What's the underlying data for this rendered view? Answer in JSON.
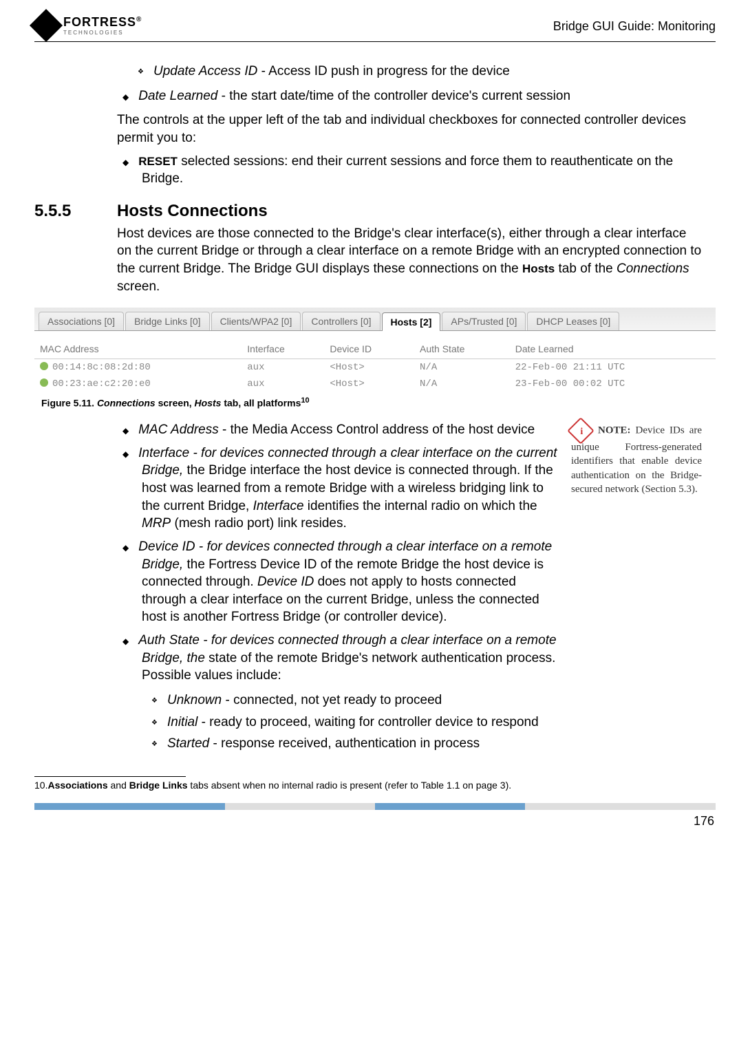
{
  "header": {
    "logo_main": "FORTRESS",
    "logo_sub": "TECHNOLOGIES",
    "right": "Bridge GUI Guide: Monitoring"
  },
  "intro": {
    "sub_item_term": "Update Access ID",
    "sub_item_rest": " - Access ID push in progress for the device",
    "date_learned_term": "Date Learned",
    "date_learned_rest": " - the start date/time of the controller device's current session",
    "para1": "The controls at the upper left of the tab and individual checkboxes for connected controller devices permit you to:",
    "reset_caps": "RESET",
    "reset_rest": " selected sessions: end their current sessions and force them to reauthenticate on the Bridge."
  },
  "section": {
    "num": "5.5.5",
    "title": "Hosts Connections",
    "para_a": "Host devices are those connected to the Bridge's clear interface(s), either through a clear interface on the current Bridge or through a clear interface on a remote Bridge with an encrypted connection to the current Bridge. The Bridge GUI displays these connections on the ",
    "hosts_bold": "Hosts",
    "para_b": " tab of the ",
    "connections_ital": "Connections",
    "para_c": " screen."
  },
  "tabs": [
    "Associations [0]",
    "Bridge Links [0]",
    "Clients/WPA2 [0]",
    "Controllers [0]",
    "Hosts [2]",
    "APs/Trusted [0]",
    "DHCP Leases [0]"
  ],
  "table": {
    "headers": [
      "MAC Address",
      "Interface",
      "Device ID",
      "Auth State",
      "Date Learned"
    ],
    "rows": [
      {
        "mac": "00:14:8c:08:2d:80",
        "iface": "aux",
        "dev": "<Host>",
        "auth": "N/A",
        "date": "22-Feb-00 21:11 UTC"
      },
      {
        "mac": "00:23:ae:c2:20:e0",
        "iface": "aux",
        "dev": "<Host>",
        "auth": "N/A",
        "date": "23-Feb-00 00:02 UTC"
      }
    ]
  },
  "caption": {
    "prefix": "Figure 5.11. ",
    "ital1": "Connections",
    "mid": " screen, ",
    "ital2": "Hosts",
    "suffix": " tab, all platforms",
    "fn": "10"
  },
  "defs": {
    "mac_term": "MAC Address",
    "mac_rest": " - the Media Access Control address of the host device",
    "iface_term": "Interface",
    "iface_ital": " - for devices connected through a clear interface on the current Bridge,",
    "iface_rest_a": " the Bridge interface the host device is connected through. If the host was learned from a remote Bridge with a wireless bridging link to the current Bridge, ",
    "iface_ital2": "Interface",
    "iface_rest_b": " identifies the internal radio on which the ",
    "mrp_ital": "MRP",
    "iface_rest_c": " (mesh radio port) link resides.",
    "dev_term": "Device ID",
    "dev_ital": " - for devices connected through a clear interface on a remote Bridge,",
    "dev_rest_a": " the Fortress Device ID of the remote Bridge the host device is connected through. ",
    "dev_ital2": "Device ID",
    "dev_rest_b": " does not apply to hosts connected through a clear interface on the current Bridge, unless the connected host is another Fortress Bridge (or controller device).",
    "auth_term": "Auth State",
    "auth_ital": " - for devices connected through a clear interface on a remote Bridge, the",
    "auth_rest": " state of the remote Bridge's network authentication process. Possible values include:",
    "unk_term": "Unknown",
    "unk_rest": " - connected, not yet ready to proceed",
    "init_term": "Initial",
    "init_rest": " - ready to proceed, waiting for controller device to respond",
    "start_term": "Started",
    "start_rest": " - response received, authentication in process"
  },
  "note": {
    "label": "NOTE:",
    "text": " Device IDs are unique Fortress-generated identifiers that enable device authentication on the Bridge-secured network (Section 5.3)."
  },
  "footnote": {
    "num": "10.",
    "b1": "Associations",
    "mid": " and ",
    "b2": "Bridge Links",
    "rest": " tabs absent when no internal radio is present (refer to Table 1.1 on page 3)."
  },
  "page_num": "176"
}
